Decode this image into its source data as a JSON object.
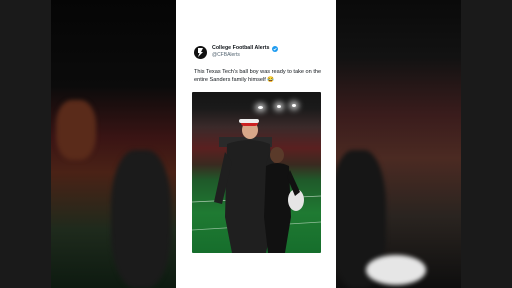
{
  "post": {
    "display_name": "College Football Alerts",
    "handle": "@CFBAlerts",
    "text": "This Texas Tech's ball boy was ready to take on the entire Sanders family himself 😂"
  },
  "icons": {
    "avatar": "alert-logo-icon",
    "verified": "verified-badge-icon",
    "play": "video-frame"
  },
  "colors": {
    "verified_blue": "#1d9bf0",
    "card_bg": "#ffffff",
    "text_primary": "#0f1419",
    "text_secondary": "#536471"
  }
}
